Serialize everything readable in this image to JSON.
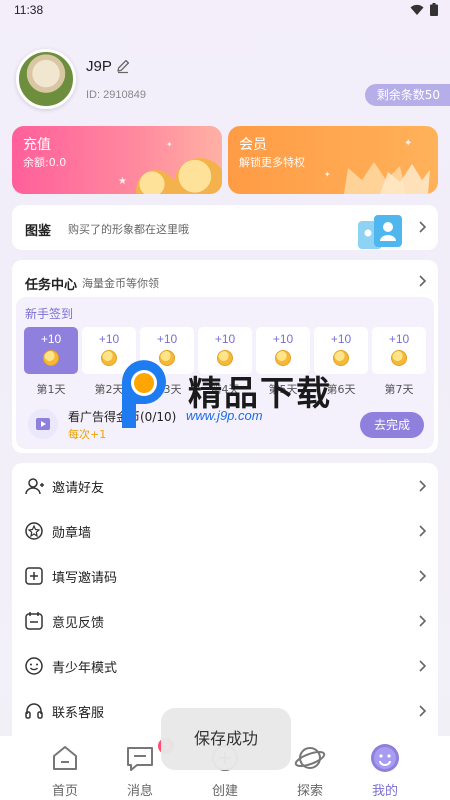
{
  "status_bar": {
    "time": "11:38"
  },
  "profile": {
    "username": "J9P",
    "user_id": "ID: 2910849",
    "remaining_badge": "剩余条数50"
  },
  "cards": {
    "recharge": {
      "title": "充值",
      "subtitle": "余额:0.0"
    },
    "member": {
      "title": "会员",
      "subtitle": "解锁更多特权"
    }
  },
  "gallery": {
    "title": "图鉴",
    "desc": "购买了的形象都在这里哦"
  },
  "task_center": {
    "title": "任务中心",
    "desc": "海量金币等你领",
    "signin_label": "新手签到",
    "days": [
      {
        "reward": "+10",
        "label": "第1天"
      },
      {
        "reward": "+10",
        "label": "第2天"
      },
      {
        "reward": "+10",
        "label": "第3天"
      },
      {
        "reward": "+10",
        "label": "第4天"
      },
      {
        "reward": "+10",
        "label": "第5天"
      },
      {
        "reward": "+10",
        "label": "第6天"
      },
      {
        "reward": "+10",
        "label": "第7天"
      }
    ],
    "ad": {
      "title": "看广告得金币(0/10)",
      "subtitle": "每次+1",
      "button": "去完成"
    }
  },
  "watermark": {
    "text": "精品下载",
    "url": "www.j9p.com"
  },
  "menu": [
    {
      "label": "邀请好友",
      "icon": "user-plus-icon"
    },
    {
      "label": "勋章墙",
      "icon": "medal-icon"
    },
    {
      "label": "填写邀请码",
      "icon": "plus-square-icon"
    },
    {
      "label": "意见反馈",
      "icon": "feedback-icon"
    },
    {
      "label": "青少年模式",
      "icon": "smile-icon"
    },
    {
      "label": "联系客服",
      "icon": "headset-icon"
    }
  ],
  "tabs": [
    {
      "label": "首页",
      "icon": "home-icon"
    },
    {
      "label": "消息",
      "icon": "message-icon",
      "badge": "5"
    },
    {
      "label": "创建",
      "icon": "create-icon"
    },
    {
      "label": "探索",
      "icon": "planet-icon"
    },
    {
      "label": "我的",
      "icon": "profile-smile-icon"
    }
  ],
  "toast": "保存成功",
  "colors": {
    "accent": "#8e80dc",
    "recharge": "#ff5f9a",
    "member": "#ff9b45",
    "badge": "#ff4d6d"
  }
}
